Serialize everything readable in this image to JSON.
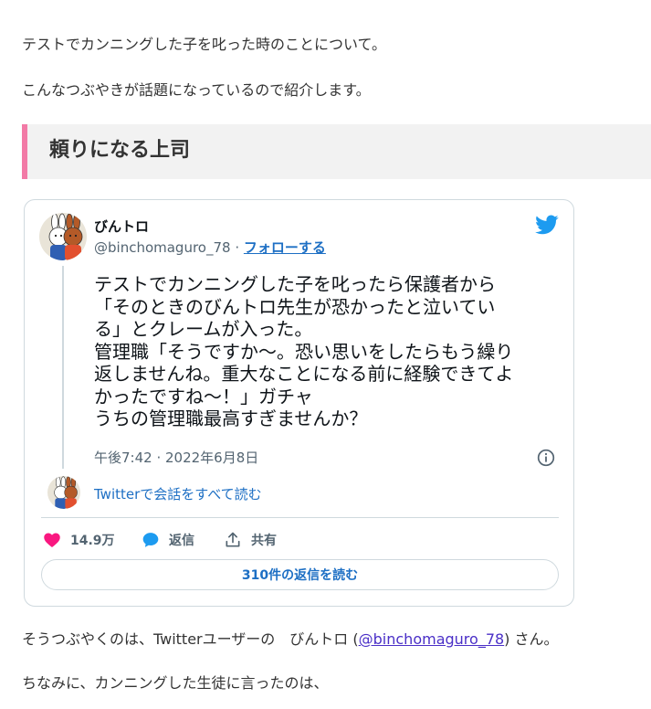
{
  "article": {
    "intro_line1": "テストでカンニングした子を叱った時のことについて。",
    "intro_line2": "こんなつぶやきが話題になっているので紹介します。",
    "heading": "頼りになる上司",
    "outro_prefix": "そうつぶやくのは、Twitterユーザーの　びんトロ (",
    "outro_link": "@binchomaguro_78",
    "outro_suffix": ") さん。",
    "closing_line": "ちなみに、カンニングした生徒に言ったのは、"
  },
  "tweet": {
    "author_name": "びんトロ",
    "handle": "@binchomaguro_78",
    "separator": " · ",
    "follow_label": "フォローする",
    "text_lines": [
      "テストでカンニングした子を叱ったら保護者から",
      "「そのときのびんトロ先生が恐かったと泣いてい",
      "る」とクレームが入った。",
      "管理職「そうですか～。恐い思いをしたらもう繰り",
      "返しませんね。重大なことになる前に経験できてよ",
      "かったですね～！」ガチャ",
      "うちの管理職最高すぎませんか？"
    ],
    "timestamp": "午後7:42 · 2022年6月8日",
    "read_conversation": "Twitterで会話をすべて読む",
    "likes": "14.9万",
    "reply_label": "返信",
    "share_label": "共有",
    "replies_button": "310件の返信を読む"
  },
  "icons": {
    "brand": "twitter-bird-icon",
    "info": "info-icon",
    "like": "heart-icon",
    "reply": "reply-bubble-icon",
    "share": "share-icon"
  },
  "colors": {
    "heading_accent": "#f27aa6",
    "heading_bg": "#f2f2f2",
    "twitter_blue": "#1d9bf0",
    "link_blue": "#1d6fc4",
    "like_pink": "#f91880",
    "text_dark": "#0f1419",
    "text_muted": "#536471",
    "card_border": "#cfd9de"
  }
}
